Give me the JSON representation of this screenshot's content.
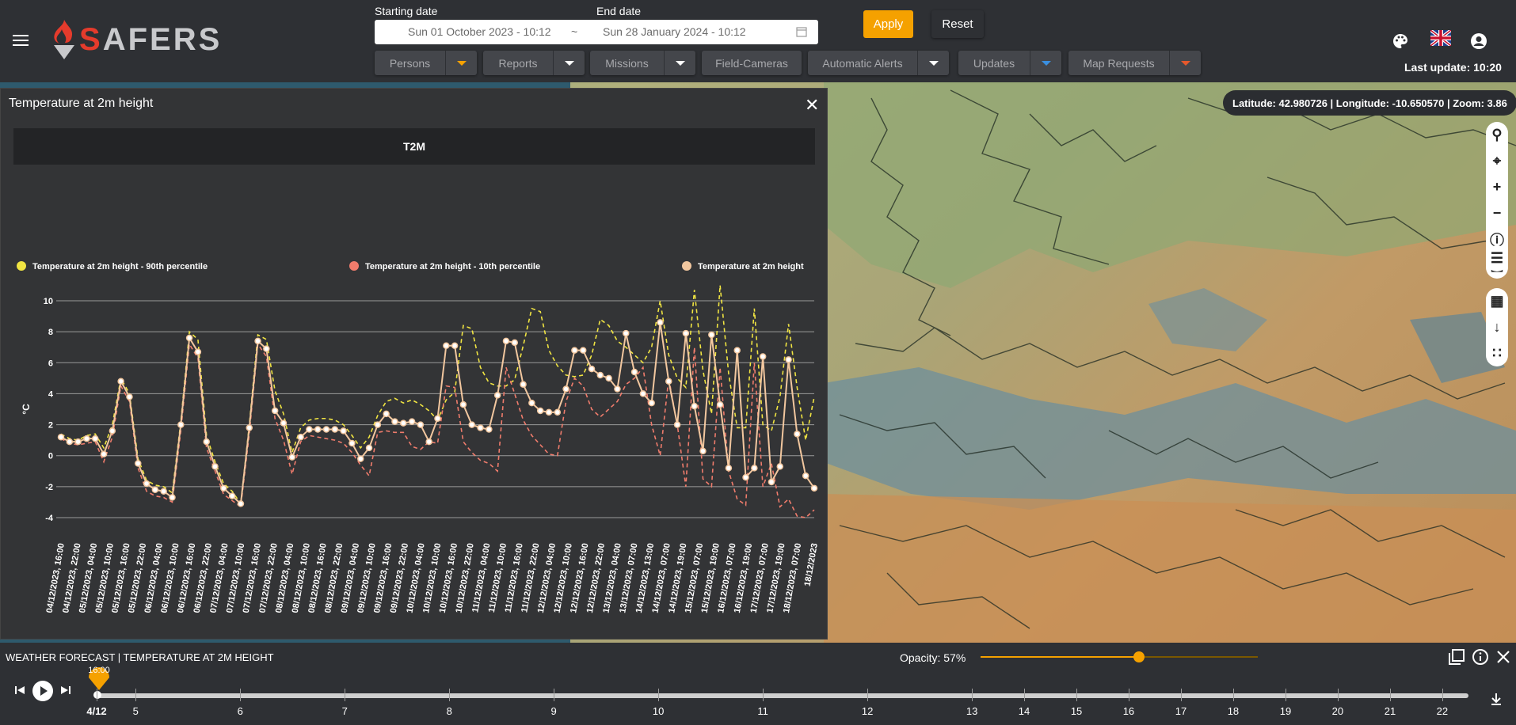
{
  "app": {
    "brand": "SAFERS",
    "brand_first": "S",
    "brand_rest": "AFERS"
  },
  "dates": {
    "start_label": "Starting date",
    "end_label": "End date",
    "start_value": "Sun 01 October 2023 - 10:12",
    "separator": "~",
    "end_value": "Sun 28 January 2024 - 10:12"
  },
  "actions": {
    "apply": "Apply",
    "reset": "Reset"
  },
  "filters": [
    {
      "label": "Persons",
      "caret_color": "#f5a100"
    },
    {
      "label": "Reports",
      "caret_color": "#ffffff"
    },
    {
      "label": "Missions",
      "caret_color": "#ffffff"
    },
    {
      "label": "Field-Cameras"
    },
    {
      "label": "Automatic Alerts",
      "caret_color": "#ffffff"
    },
    {
      "label": "Updates",
      "caret_color": "#3a8fe0"
    },
    {
      "label": "Map Requests",
      "caret_color": "#e5582c"
    }
  ],
  "header_icons": [
    "palette-icon",
    "uk-flag-icon",
    "account-icon"
  ],
  "last_update": "Last update: 10:20",
  "map": {
    "coords": "Latitude: 42.980726 | Longitude: -10.650570 | Zoom: 3.86",
    "controls": [
      "search-icon",
      "locate-icon",
      "zoom-in-icon",
      "zoom-out-icon",
      "info-icon",
      "basemap-icon",
      "layers-icon",
      "table-icon",
      "download-icon",
      "settings-icon"
    ]
  },
  "panel": {
    "title": "Temperature at 2m height",
    "close": "✕"
  },
  "chart_data": {
    "type": "line",
    "title": "T2M",
    "ylabel": "°C",
    "ylim": [
      -4,
      10
    ],
    "yticks": [
      10,
      8,
      6,
      4,
      2,
      0,
      -2,
      -4
    ],
    "grid": true,
    "legend_position": "top",
    "x": [
      "04/12/2023, 16:00",
      "04/12/2023, 22:00",
      "05/12/2023, 04:00",
      "05/12/2023, 10:00",
      "05/12/2023, 16:00",
      "05/12/2023, 22:00",
      "06/12/2023, 04:00",
      "06/12/2023, 10:00",
      "06/12/2023, 16:00",
      "06/12/2023, 22:00",
      "07/12/2023, 04:00",
      "07/12/2023, 10:00",
      "07/12/2023, 16:00",
      "07/12/2023, 22:00",
      "08/12/2023, 04:00",
      "08/12/2023, 10:00",
      "08/12/2023, 16:00",
      "08/12/2023, 22:00",
      "09/12/2023, 04:00",
      "09/12/2023, 10:00",
      "09/12/2023, 16:00",
      "09/12/2023, 22:00",
      "10/12/2023, 04:00",
      "10/12/2023, 10:00",
      "10/12/2023, 16:00",
      "10/12/2023, 22:00",
      "11/12/2023, 04:00",
      "11/12/2023, 10:00",
      "11/12/2023, 16:00",
      "11/12/2023, 22:00",
      "12/12/2023, 04:00",
      "12/12/2023, 10:00",
      "12/12/2023, 16:00",
      "12/12/2023, 22:00",
      "13/12/2023, 04:00",
      "13/12/2023, 07:00",
      "14/12/2023, 13:00",
      "14/12/2023, 07:00",
      "14/12/2023, 19:00",
      "15/12/2023, 07:00",
      "15/12/2023, 19:00",
      "16/12/2023, 07:00",
      "16/12/2023, 19:00",
      "17/12/2023, 07:00",
      "17/12/2023, 19:00",
      "18/12/2023, 07:00",
      "18/12/2023"
    ],
    "series": [
      {
        "name": "Temperature at 2m height - 90th percentile",
        "color": "#f0e442",
        "style": "dashed",
        "values": [
          1.4,
          1.1,
          1.0,
          1.3,
          1.4,
          0.5,
          2.0,
          5.0,
          4.0,
          -0.2,
          -1.6,
          -1.9,
          -2.0,
          -2.4,
          2.2,
          8.0,
          7.5,
          1.3,
          -0.4,
          -1.8,
          -2.3,
          -3.1,
          2.0,
          7.8,
          7.5,
          4.2,
          2.7,
          0.2,
          1.8,
          2.3,
          2.4,
          2.4,
          2.3,
          2.0,
          1.3,
          0.5,
          1.2,
          2.6,
          3.5,
          3.7,
          3.4,
          3.6,
          3.3,
          2.9,
          2.3,
          3.6,
          4.1,
          8.4,
          8.2,
          5.7,
          4.7,
          4.5,
          4.5,
          4.9,
          7.1,
          9.5,
          9.3,
          6.8,
          5.8,
          5.2,
          5.1,
          5.2,
          6.5,
          8.8,
          8.4,
          7.4,
          7.0,
          6.5,
          6.0,
          7.0,
          10.0,
          6.5,
          5.0,
          4.4,
          10.7,
          5.5,
          2.7,
          11.0,
          5.3,
          1.8,
          1.8,
          9.5,
          2.0,
          1.6,
          3.8,
          8.5,
          4.4,
          1.0,
          3.8
        ],
        "note": "sampled values"
      },
      {
        "name": "Temperature at 2m height - 10th percentile",
        "color": "#f07c6c",
        "style": "dashed",
        "values": [
          1.1,
          0.8,
          0.7,
          0.8,
          0.9,
          -0.4,
          1.2,
          4.5,
          3.5,
          -0.8,
          -2.3,
          -2.6,
          -2.7,
          -3.0,
          1.6,
          7.2,
          6.3,
          0.5,
          -1.0,
          -2.5,
          -2.9,
          -3.3,
          1.4,
          7.2,
          6.4,
          2.4,
          1.0,
          -1.2,
          0.9,
          1.3,
          1.2,
          1.1,
          1.0,
          0.8,
          0.2,
          -0.6,
          -1.3,
          1.5,
          1.6,
          1.5,
          1.5,
          0.6,
          0.4,
          0.9,
          0.8,
          4.5,
          4.4,
          0.9,
          0.2,
          -0.3,
          -0.5,
          -1.0,
          5.7,
          4.0,
          2.3,
          1.3,
          0.7,
          0.1,
          0.0,
          3.5,
          5.0,
          4.5,
          3.0,
          2.5,
          3.0,
          3.5,
          4.6,
          5.0,
          5.7,
          2.0,
          0.0,
          5.0,
          2.0,
          -2.0,
          7.0,
          -1.5,
          -2.0,
          5.7,
          -1.0,
          -2.8,
          -3.2,
          6.0,
          -2.0,
          -0.5,
          -3.3,
          -2.8,
          -3.9,
          -4.0,
          -3.5
        ]
      },
      {
        "name": "Temperature at 2m height",
        "color": "#f2c79f",
        "style": "solid",
        "values": [
          1.2,
          0.9,
          0.9,
          1.1,
          1.1,
          0.1,
          1.6,
          4.8,
          3.8,
          -0.5,
          -1.8,
          -2.2,
          -2.3,
          -2.7,
          2.0,
          7.6,
          6.7,
          0.9,
          -0.7,
          -2.1,
          -2.6,
          -3.1,
          1.8,
          7.4,
          6.9,
          2.9,
          2.1,
          -0.1,
          1.2,
          1.7,
          1.7,
          1.7,
          1.7,
          1.6,
          0.8,
          -0.2,
          0.5,
          2.0,
          2.7,
          2.2,
          2.1,
          2.2,
          2.0,
          0.9,
          2.4,
          7.1,
          7.1,
          3.3,
          2.0,
          1.8,
          1.7,
          3.9,
          7.4,
          7.3,
          4.6,
          3.4,
          2.9,
          2.8,
          2.8,
          4.3,
          6.8,
          6.8,
          5.6,
          5.2,
          5.0,
          4.3,
          7.9,
          5.4,
          4.0,
          3.4,
          8.6,
          4.8,
          2.0,
          7.9,
          3.2,
          0.3,
          7.8,
          3.3,
          -0.8,
          6.8,
          -1.4,
          -0.8,
          6.4,
          -1.7,
          -0.7,
          6.2,
          1.4,
          -1.3,
          -2.1
        ]
      }
    ]
  },
  "bottom": {
    "layer_title": "WEATHER FORECAST | TEMPERATURE AT 2M HEIGHT",
    "opacity_label": "Opacity: 57%",
    "opacity": 0.57,
    "pin_time": "16:00",
    "timeline_labels": [
      {
        "t": "4/12",
        "pos": 0.0
      },
      {
        "t": "5",
        "pos": 0.0237
      },
      {
        "t": "6",
        "pos": 0.0872
      },
      {
        "t": "7",
        "pos": 0.1507
      },
      {
        "t": "8",
        "pos": 0.2142
      },
      {
        "t": "9",
        "pos": 0.2777
      },
      {
        "t": "10",
        "pos": 0.3412
      },
      {
        "t": "11",
        "pos": 0.4047
      },
      {
        "t": "12",
        "pos": 0.4682
      },
      {
        "t": "13",
        "pos": 0.5317
      },
      {
        "t": "14",
        "pos": 0.5634
      },
      {
        "t": "15",
        "pos": 0.5952
      },
      {
        "t": "16",
        "pos": 0.6269
      },
      {
        "t": "17",
        "pos": 0.6587
      },
      {
        "t": "18",
        "pos": 0.6904
      },
      {
        "t": "19",
        "pos": 0.7222
      },
      {
        "t": "20",
        "pos": 0.7539
      },
      {
        "t": "21",
        "pos": 0.7857
      },
      {
        "t": "22",
        "pos": 0.8174
      }
    ]
  }
}
